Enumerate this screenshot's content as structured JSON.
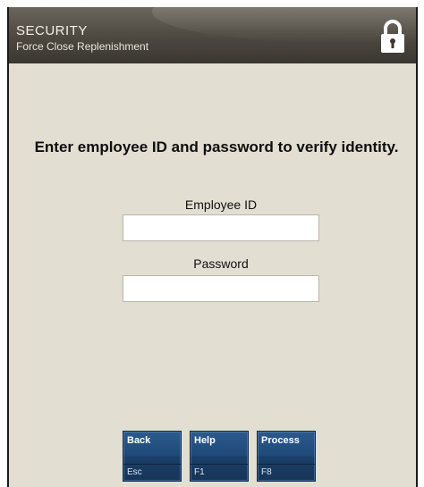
{
  "header": {
    "title": "SECURITY",
    "subtitle": "Force Close Replenishment",
    "icon": "lock-icon"
  },
  "prompt": "Enter employee ID and password to verify identity.",
  "form": {
    "employee_id": {
      "label": "Employee ID",
      "value": ""
    },
    "password": {
      "label": "Password",
      "value": ""
    }
  },
  "function_keys": [
    {
      "label": "Back",
      "shortcut": "Esc"
    },
    {
      "label": "Help",
      "shortcut": "F1"
    },
    {
      "label": "Process",
      "shortcut": "F8"
    }
  ],
  "colors": {
    "background": "#e2ded1",
    "header": "#4c4840",
    "button": "#1f4a7a"
  }
}
